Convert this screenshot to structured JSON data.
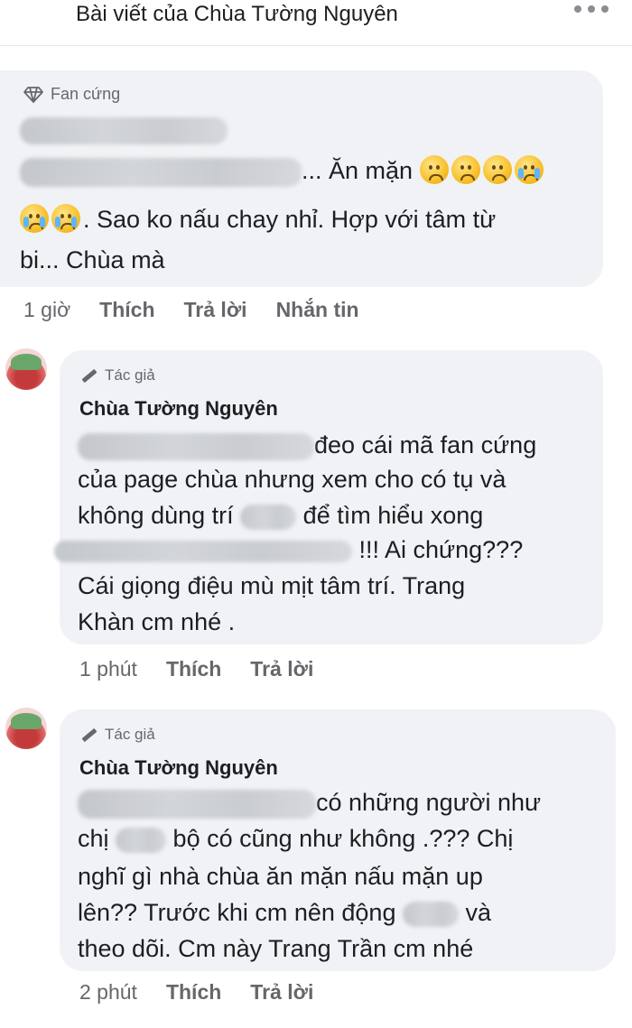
{
  "header": {
    "title": "Bài viết của Chùa Tường Nguyên"
  },
  "comment1": {
    "badge": "Fan cứng",
    "line1_end": "... Ăn mặn",
    "line2": ". Sao ko nấu chay nhỉ. Hợp với tâm từ",
    "line3": "bi... Chùa mà",
    "time": "1 giờ",
    "like": "Thích",
    "reply": "Trả lời",
    "message": "Nhắn tin"
  },
  "comment2": {
    "badge": "Tác giả",
    "author": "Chùa Tường Nguyên",
    "line1_end": "đeo cái mã fan cứng",
    "line2": "của page chùa nhưng xem cho có tụ và",
    "line3_a": "không dùng trí",
    "line3_b": "để tìm hiểu xong",
    "line4_end": "!!! Ai chứng???",
    "line5": "Cái giọng điệu mù mịt tâm trí. Trang",
    "line6": "Khàn cm nhé .",
    "time": "1 phút",
    "like": "Thích",
    "reply": "Trả lời"
  },
  "comment3": {
    "badge": "Tác giả",
    "author": "Chùa Tường Nguyên",
    "line1_end": "có những người như",
    "line2_a": "chị",
    "line2_b": "bộ có cũng như không .??? Chị",
    "line3": "nghĩ gì nhà chùa ăn mặn nấu mặn up",
    "line4_a": "lên?? Trước khi cm nên động",
    "line4_b": "và",
    "line5": "theo dõi. Cm này Trang Trần cm nhé",
    "time": "2 phút",
    "like": "Thích",
    "reply": "Trả lời"
  }
}
